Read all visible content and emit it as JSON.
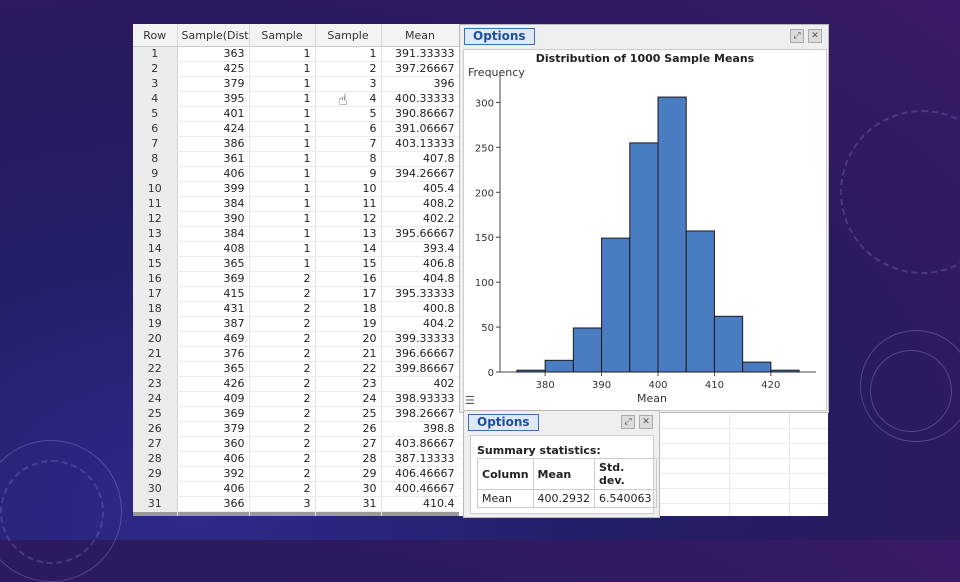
{
  "spreadsheet": {
    "columns": [
      "Row",
      "Sample(Dist",
      "Sample",
      "Sample",
      "Mean"
    ],
    "rows": [
      [
        "1",
        "363",
        "1",
        "1",
        "391.33333"
      ],
      [
        "2",
        "425",
        "1",
        "2",
        "397.26667"
      ],
      [
        "3",
        "379",
        "1",
        "3",
        "396"
      ],
      [
        "4",
        "395",
        "1",
        "4",
        "400.33333"
      ],
      [
        "5",
        "401",
        "1",
        "5",
        "390.86667"
      ],
      [
        "6",
        "424",
        "1",
        "6",
        "391.06667"
      ],
      [
        "7",
        "386",
        "1",
        "7",
        "403.13333"
      ],
      [
        "8",
        "361",
        "1",
        "8",
        "407.8"
      ],
      [
        "9",
        "406",
        "1",
        "9",
        "394.26667"
      ],
      [
        "10",
        "399",
        "1",
        "10",
        "405.4"
      ],
      [
        "11",
        "384",
        "1",
        "11",
        "408.2"
      ],
      [
        "12",
        "390",
        "1",
        "12",
        "402.2"
      ],
      [
        "13",
        "384",
        "1",
        "13",
        "395.66667"
      ],
      [
        "14",
        "408",
        "1",
        "14",
        "393.4"
      ],
      [
        "15",
        "365",
        "1",
        "15",
        "406.8"
      ],
      [
        "16",
        "369",
        "2",
        "16",
        "404.8"
      ],
      [
        "17",
        "415",
        "2",
        "17",
        "395.33333"
      ],
      [
        "18",
        "431",
        "2",
        "18",
        "400.8"
      ],
      [
        "19",
        "387",
        "2",
        "19",
        "404.2"
      ],
      [
        "20",
        "469",
        "2",
        "20",
        "399.33333"
      ],
      [
        "21",
        "376",
        "2",
        "21",
        "396.66667"
      ],
      [
        "22",
        "365",
        "2",
        "22",
        "399.86667"
      ],
      [
        "23",
        "426",
        "2",
        "23",
        "402"
      ],
      [
        "24",
        "409",
        "2",
        "24",
        "398.93333"
      ],
      [
        "25",
        "369",
        "2",
        "25",
        "398.26667"
      ],
      [
        "26",
        "379",
        "2",
        "26",
        "398.8"
      ],
      [
        "27",
        "360",
        "2",
        "27",
        "403.86667"
      ],
      [
        "28",
        "406",
        "2",
        "28",
        "387.13333"
      ],
      [
        "29",
        "392",
        "2",
        "29",
        "406.46667"
      ],
      [
        "30",
        "406",
        "2",
        "30",
        "400.46667"
      ],
      [
        "31",
        "366",
        "3",
        "31",
        "410.4"
      ]
    ]
  },
  "histogram_panel": {
    "options_label": "Options"
  },
  "chart_data": {
    "type": "bar",
    "title": "Distribution of 1000 Sample Means",
    "xlabel": "Mean",
    "ylabel": "Frequency",
    "bin_edges": [
      375,
      380,
      385,
      390,
      395,
      400,
      405,
      410,
      415,
      420,
      425
    ],
    "values": [
      2,
      13,
      49,
      149,
      255,
      306,
      157,
      62,
      11,
      2
    ],
    "xticks": [
      380,
      390,
      400,
      410,
      420
    ],
    "yticks": [
      0,
      50,
      100,
      150,
      200,
      250,
      300
    ],
    "xlim": [
      372,
      428
    ],
    "ylim": [
      0,
      325
    ],
    "bar_color": "#4a7cc2"
  },
  "stats_panel": {
    "options_label": "Options",
    "title": "Summary statistics:",
    "headers": [
      "Column",
      "Mean",
      "Std. dev."
    ],
    "row": [
      "Mean",
      "400.2932",
      "6.540063"
    ]
  }
}
